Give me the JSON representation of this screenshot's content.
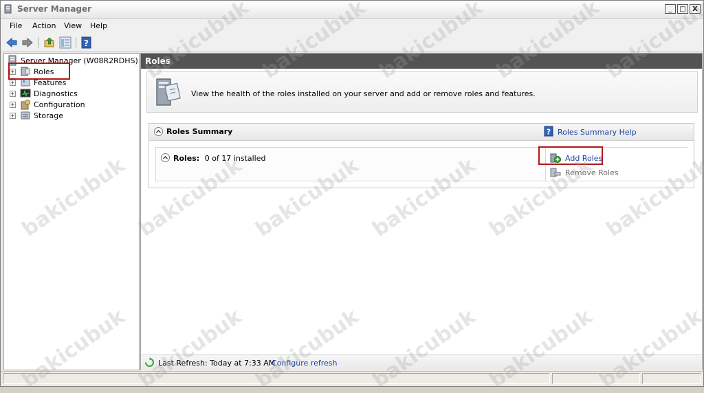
{
  "window": {
    "title": "Server Manager",
    "controls": {
      "minimize": "_",
      "maximize": "□",
      "close": "X"
    }
  },
  "menu": [
    "File",
    "Action",
    "View",
    "Help"
  ],
  "toolbar": [
    "back-arrow-icon",
    "forward-arrow-icon",
    "up-folder-icon",
    "show-hide-console-tree-icon",
    "help-icon"
  ],
  "tree": {
    "root": "Server Manager (W08R2RDHS)",
    "items": [
      "Roles",
      "Features",
      "Diagnostics",
      "Configuration",
      "Storage"
    ],
    "expander": "+",
    "selected": "Roles"
  },
  "main": {
    "header": "Roles",
    "intro": "View the health of the roles installed on your server and add or remove roles and features.",
    "summary": {
      "title": "Roles Summary",
      "help_link": "Roles Summary Help",
      "roles_label": "Roles:",
      "roles_status": "0 of 17 installed",
      "actions": [
        "Add Roles",
        "Remove Roles"
      ]
    },
    "refresh": {
      "text": "Last Refresh: Today at 7:33 AM",
      "link": "Configure refresh"
    }
  },
  "watermark": "bakicubuk",
  "colors": {
    "header_bg": "#535353",
    "link": "#1a3fa0",
    "highlight_box": "#b01818",
    "disabled_text": "#6d6d6d"
  }
}
